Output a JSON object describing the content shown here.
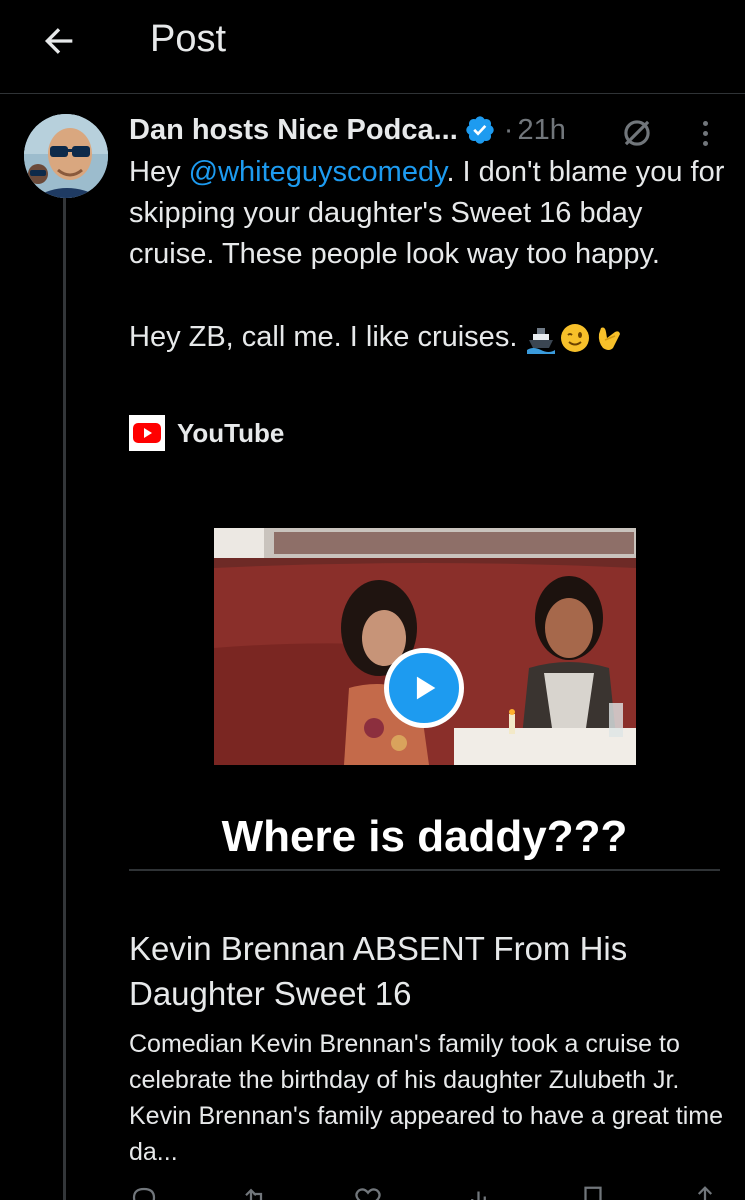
{
  "header": {
    "title": "Post"
  },
  "post": {
    "author": "Dan hosts Nice Podca...",
    "separator": "·",
    "time": "21h",
    "text_prefix": "Hey ",
    "mention": "@whiteguyscomedy",
    "text_rest": ". I don't blame you for skipping your daughter's Sweet 16 bday cruise. These people look way too happy.",
    "text_line2": "Hey ZB, call me. I like cruises.",
    "emojis": [
      "ship-emoji",
      "wink-emoji",
      "call-me-hand-emoji"
    ]
  },
  "link_card": {
    "source": "YouTube",
    "thumbnail_caption": "Where is daddy???",
    "title": "Kevin Brennan ABSENT From His Daughter Sweet 16",
    "description": "Comedian Kevin Brennan's family took a cruise to celebrate the birthday of his daughter Zulubeth Jr. Kevin Brennan's family appeared to have a great time da..."
  },
  "colors": {
    "background": "#000000",
    "text": "#e7e9ea",
    "secondary": "#71767b",
    "accent": "#1d9bf0",
    "divider": "#2f3336"
  }
}
